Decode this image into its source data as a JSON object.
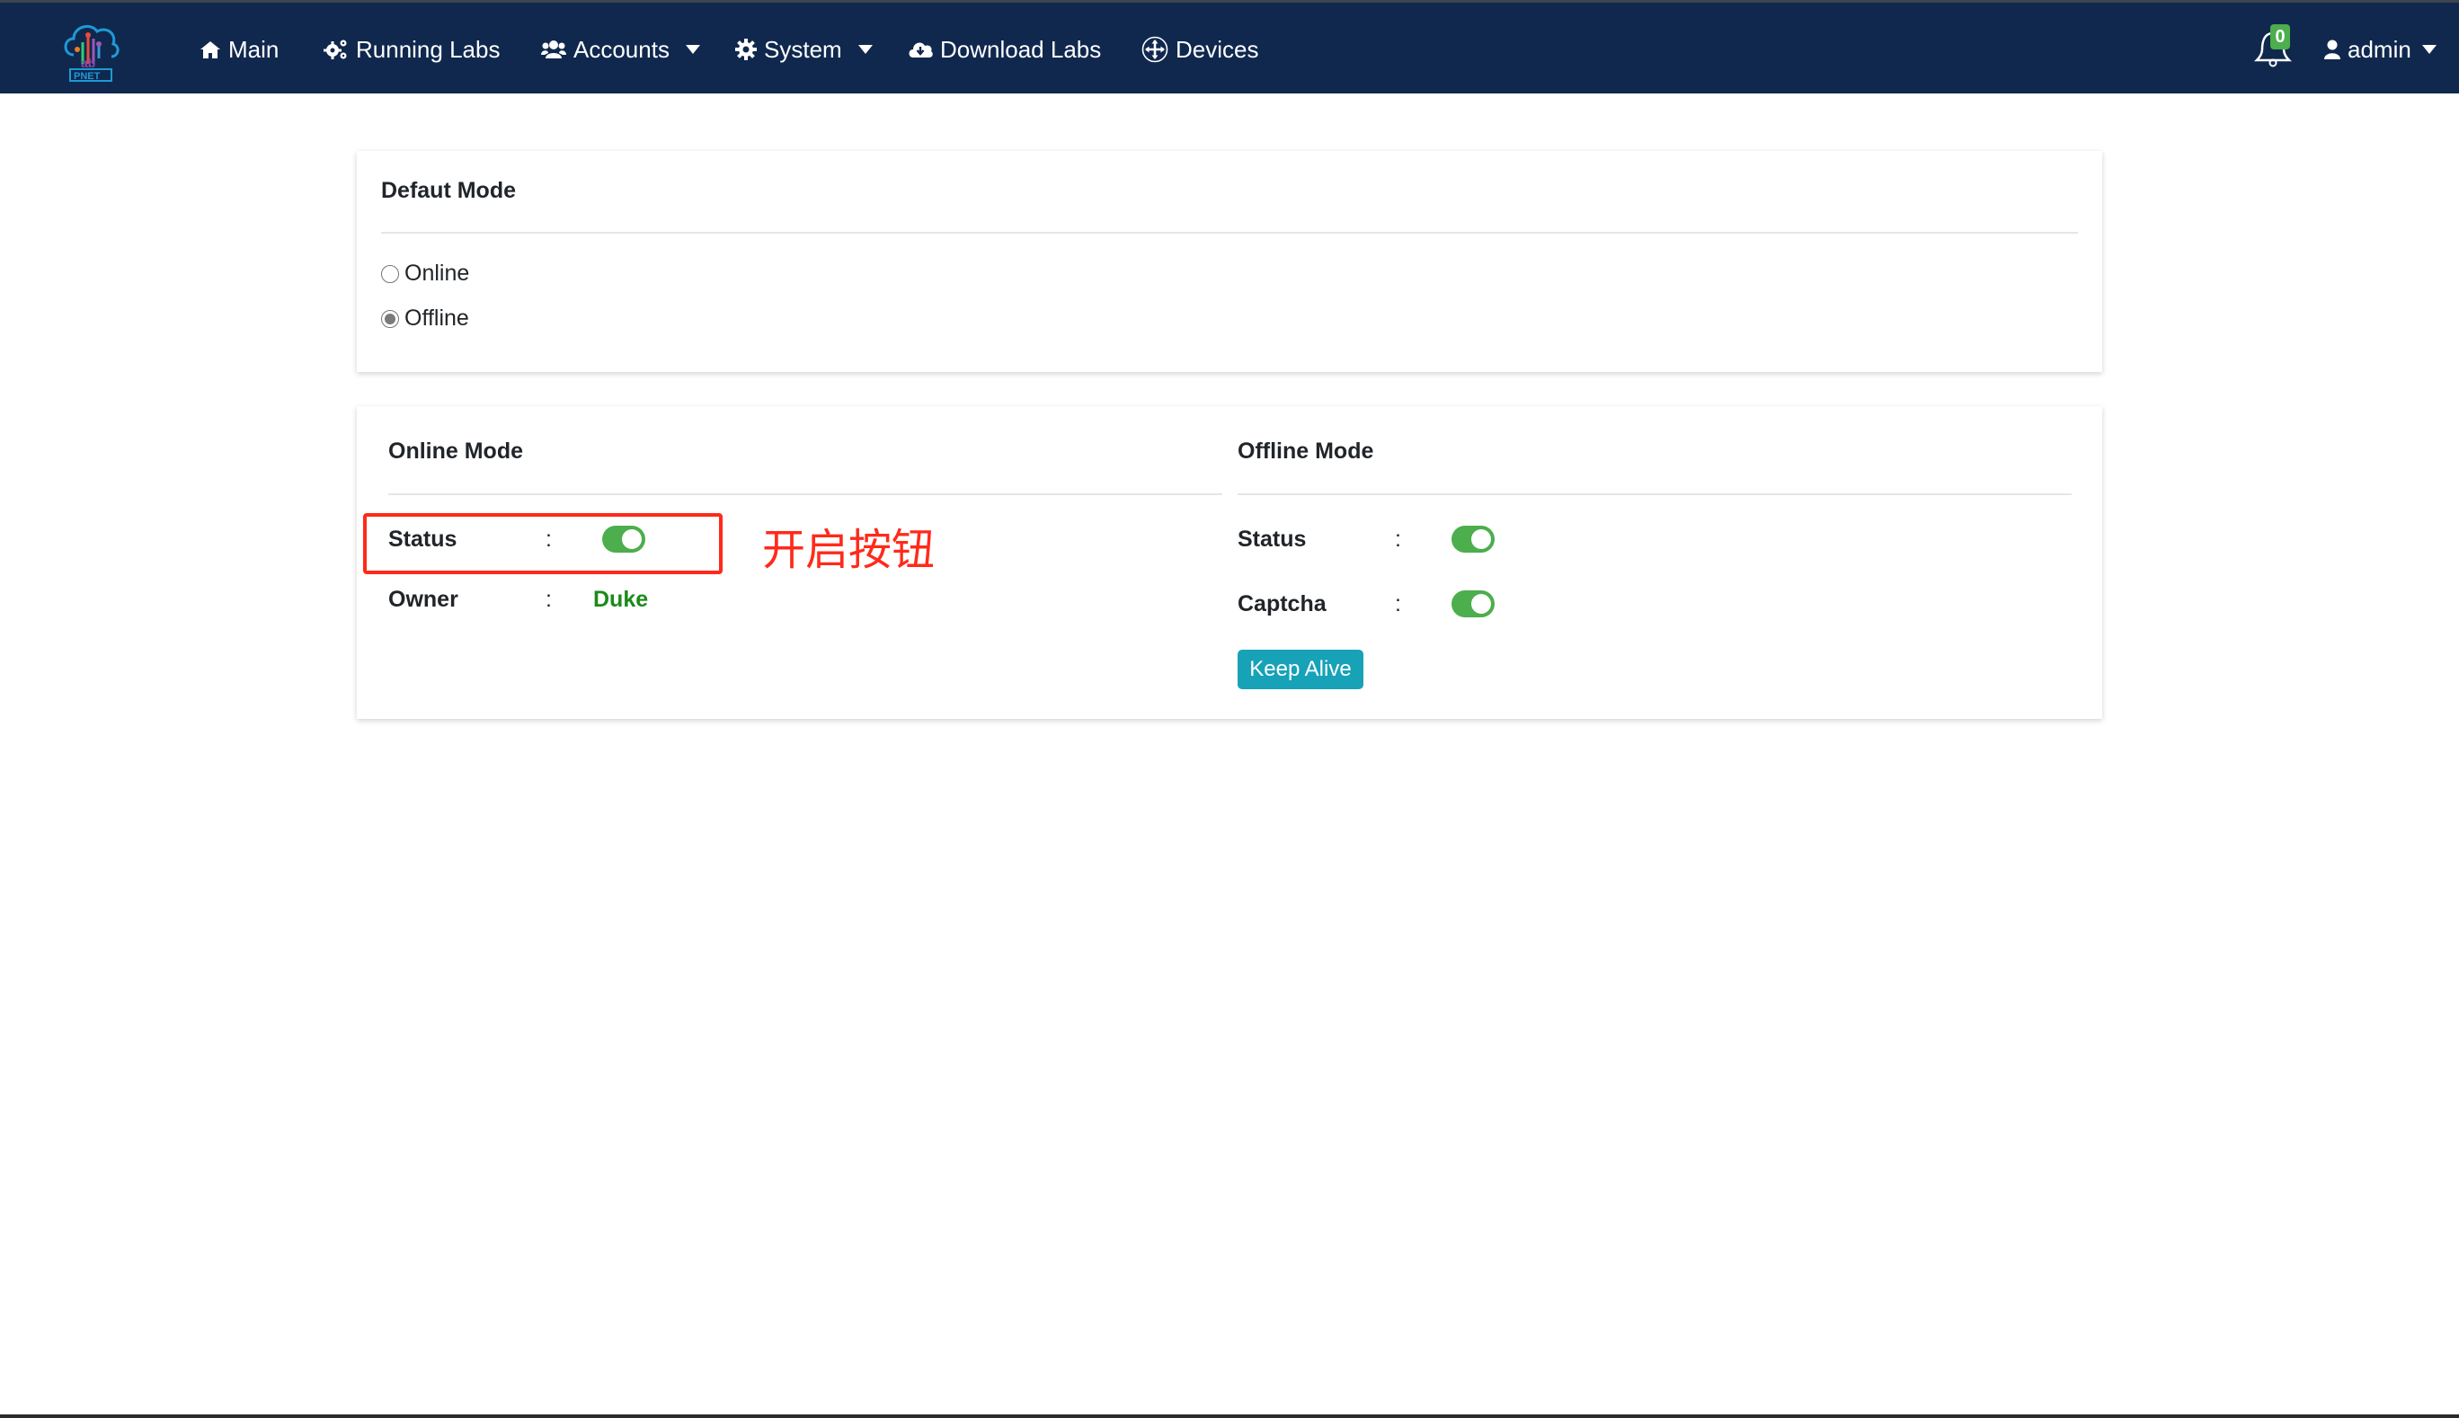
{
  "navbar": {
    "logo_text": "PNET",
    "items": [
      {
        "label": "Main",
        "icon": "home-icon"
      },
      {
        "label": "Running Labs",
        "icon": "cogs-icon"
      },
      {
        "label": "Accounts",
        "icon": "users-icon",
        "dropdown": true
      },
      {
        "label": "System",
        "icon": "gear-icon",
        "dropdown": true
      },
      {
        "label": "Download Labs",
        "icon": "cloud-download-icon"
      },
      {
        "label": "Devices",
        "icon": "arrows-move-icon"
      }
    ],
    "notifications_count": "0",
    "user_label": "admin"
  },
  "default_mode": {
    "title": "Defaut Mode",
    "options": [
      {
        "label": "Online",
        "checked": false
      },
      {
        "label": "Offline",
        "checked": true
      }
    ]
  },
  "online_mode": {
    "title": "Online Mode",
    "status_label": "Status",
    "status_on": true,
    "owner_label": "Owner",
    "owner_value": "Duke",
    "separator": ":"
  },
  "offline_mode": {
    "title": "Offline Mode",
    "status_label": "Status",
    "status_on": true,
    "captcha_label": "Captcha",
    "captcha_on": true,
    "separator": ":",
    "keep_alive_label": "Keep Alive"
  },
  "annotation": {
    "text": "开启按钮",
    "color": "#ff2a1a"
  },
  "colors": {
    "navbar_bg": "#10284e",
    "toggle_on": "#4cae4c",
    "button_info": "#17a2b8",
    "owner_text": "#1a8a1a"
  }
}
